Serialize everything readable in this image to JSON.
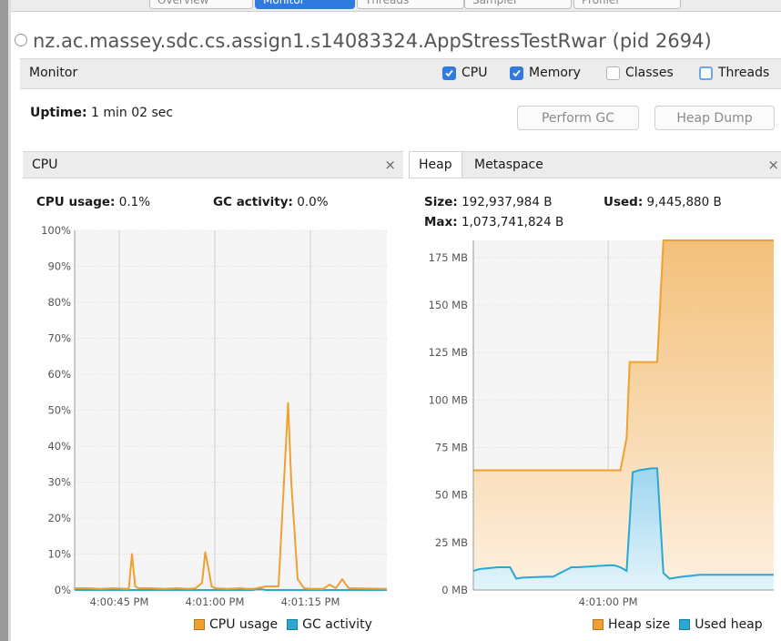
{
  "tabs": [
    "Overview",
    "Monitor",
    "Threads",
    "Sampler",
    "Profiler"
  ],
  "app": {
    "title": "nz.ac.massey.sdc.cs.assign1.s14083324.AppStressTestRwar",
    "pid": "(pid 2694)"
  },
  "monitor": {
    "label": "Monitor",
    "checkboxes": [
      {
        "label": "CPU",
        "checked": true
      },
      {
        "label": "Memory",
        "checked": true
      },
      {
        "label": "Classes",
        "checked": false
      },
      {
        "label": "Threads",
        "checked": false
      }
    ]
  },
  "uptime": {
    "label": "Uptime:",
    "value": "1 min 02 sec"
  },
  "buttons": {
    "perform_gc": "Perform GC",
    "heap_dump": "Heap Dump"
  },
  "cpu_panel": {
    "tab": "CPU",
    "close": "×",
    "usage_label": "CPU usage:",
    "usage_value": "0.1%",
    "gc_label": "GC activity:",
    "gc_value": "0.0%",
    "legend": [
      "CPU usage",
      "GC activity"
    ]
  },
  "heap_panel": {
    "tabs": [
      "Heap",
      "Metaspace"
    ],
    "close": "×",
    "size_label": "Size:",
    "size_value": "192,937,984 B",
    "used_label": "Used:",
    "used_value": "9,445,880 B",
    "max_label": "Max:",
    "max_value": "1,073,741,824 B",
    "legend": [
      "Heap size",
      "Used heap"
    ]
  },
  "colors": {
    "orange": "#f0a030",
    "blue": "#2aa7d3",
    "accent": "#2f7be0"
  },
  "chart_data": [
    {
      "type": "line",
      "yticks": [
        "100%",
        "90%",
        "80%",
        "70%",
        "60%",
        "50%",
        "40%",
        "30%",
        "20%",
        "10%",
        "0%"
      ],
      "ylim": [
        0,
        100
      ],
      "xticks": [
        "4:00:45 PM",
        "4:01:00 PM",
        "4:01:15 PM"
      ],
      "xtick_values": [
        45,
        60,
        75
      ],
      "xlim": [
        38,
        87
      ],
      "series": [
        {
          "name": "CPU usage",
          "x": [
            38,
            40,
            42,
            44,
            46,
            46.5,
            47,
            47.5,
            48,
            50,
            52,
            54,
            56,
            57,
            58,
            58.5,
            59,
            59.5,
            60,
            62,
            64,
            65,
            66,
            68,
            70,
            71.5,
            72,
            73,
            74,
            75,
            77,
            78,
            79,
            80,
            81,
            87
          ],
          "y": [
            0.5,
            0.5,
            0.3,
            0.5,
            0.3,
            0.3,
            10,
            1,
            0.5,
            0.5,
            0.3,
            0.5,
            0.3,
            0.5,
            2,
            10.5,
            6,
            1,
            0.5,
            0.3,
            0.5,
            0.3,
            0.3,
            1,
            1,
            52,
            30,
            3,
            0.5,
            0.3,
            0.3,
            1.5,
            0.5,
            3,
            0.5,
            0.3
          ]
        },
        {
          "name": "GC activity",
          "x": [
            38,
            66,
            67,
            68,
            87
          ],
          "y": [
            0,
            0,
            0.3,
            0,
            0
          ]
        }
      ]
    },
    {
      "type": "area",
      "yticks": [
        "175 MB",
        "150 MB",
        "125 MB",
        "100 MB",
        "75 MB",
        "50 MB",
        "25 MB",
        "0 MB"
      ],
      "ylim": [
        0,
        184
      ],
      "xticks": [
        "4:01:00 PM"
      ],
      "xtick_values": [
        60
      ],
      "xlim": [
        38,
        87
      ],
      "series": [
        {
          "name": "Heap size",
          "x": [
            38,
            62,
            63,
            63.5,
            64,
            68,
            69,
            69.5,
            87
          ],
          "y": [
            63,
            63,
            80,
            120,
            120,
            120,
            184,
            184,
            184
          ]
        },
        {
          "name": "Used heap",
          "x": [
            38,
            39,
            42,
            44,
            45,
            46,
            50,
            51,
            54,
            55,
            60,
            61,
            62,
            63,
            64,
            65,
            67,
            68,
            69,
            70,
            72,
            75,
            87
          ],
          "y": [
            10,
            11,
            12,
            12,
            6,
            6.5,
            7,
            7,
            12,
            12,
            13,
            13,
            12,
            10,
            62,
            63,
            64,
            64,
            9,
            6,
            7,
            8,
            8
          ]
        }
      ]
    }
  ]
}
